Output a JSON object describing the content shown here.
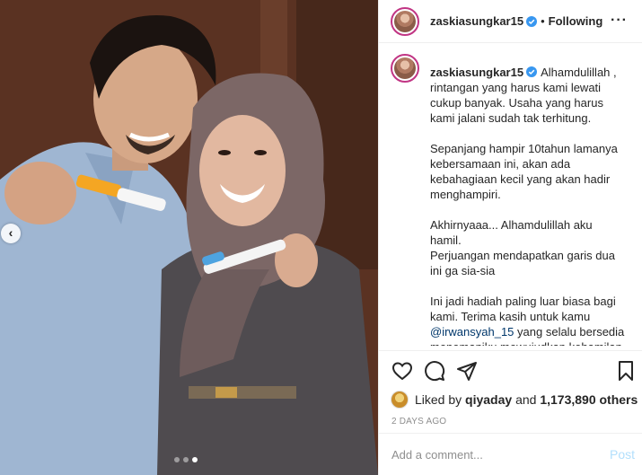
{
  "post": {
    "username": "zaskiasungkar15",
    "follow_separator": "•",
    "follow_label": "Following",
    "more_icon": "more-dots-icon"
  },
  "caption": {
    "username": "zaskiasungkar15",
    "text_1": "Alhamdulillah , rintangan yang harus kami lewati cukup banyak. Usaha yang harus kami jalani sudah tak terhitung.\n\nSepanjang hampir 10tahun lamanya kebersamaan ini, akan ada kebahagiaan kecil yang akan hadir menghampiri.\n\nAkhirnyaaa... Alhamdulillah aku hamil.\nPerjuangan mendapatkan garis dua ini ga sia-sia\n\nIni jadi hadiah paling luar biasa bagi kami. Terima kasih untuk kamu ",
    "mention": "@irwansyah_15",
    "text_2": " yang selalu bersedia menemaniku mewujudkan kehamilan"
  },
  "actions": {
    "icons": [
      "heart-icon",
      "comment-icon",
      "share-icon",
      "bookmark-icon"
    ]
  },
  "likes": {
    "prefix": "Liked by",
    "user": "qiyaday",
    "middle": "and",
    "count": "1,173,890 others"
  },
  "timestamp": "2 DAYS AGO",
  "comment": {
    "placeholder": "Add a comment...",
    "post_label": "Post"
  },
  "carousel": {
    "total_slides": 3,
    "active_slide": 3
  },
  "colors": {
    "verified": "#3897f0",
    "link": "#00376b",
    "post_disabled": "#b2dffc",
    "muted": "#8e8e8e"
  }
}
